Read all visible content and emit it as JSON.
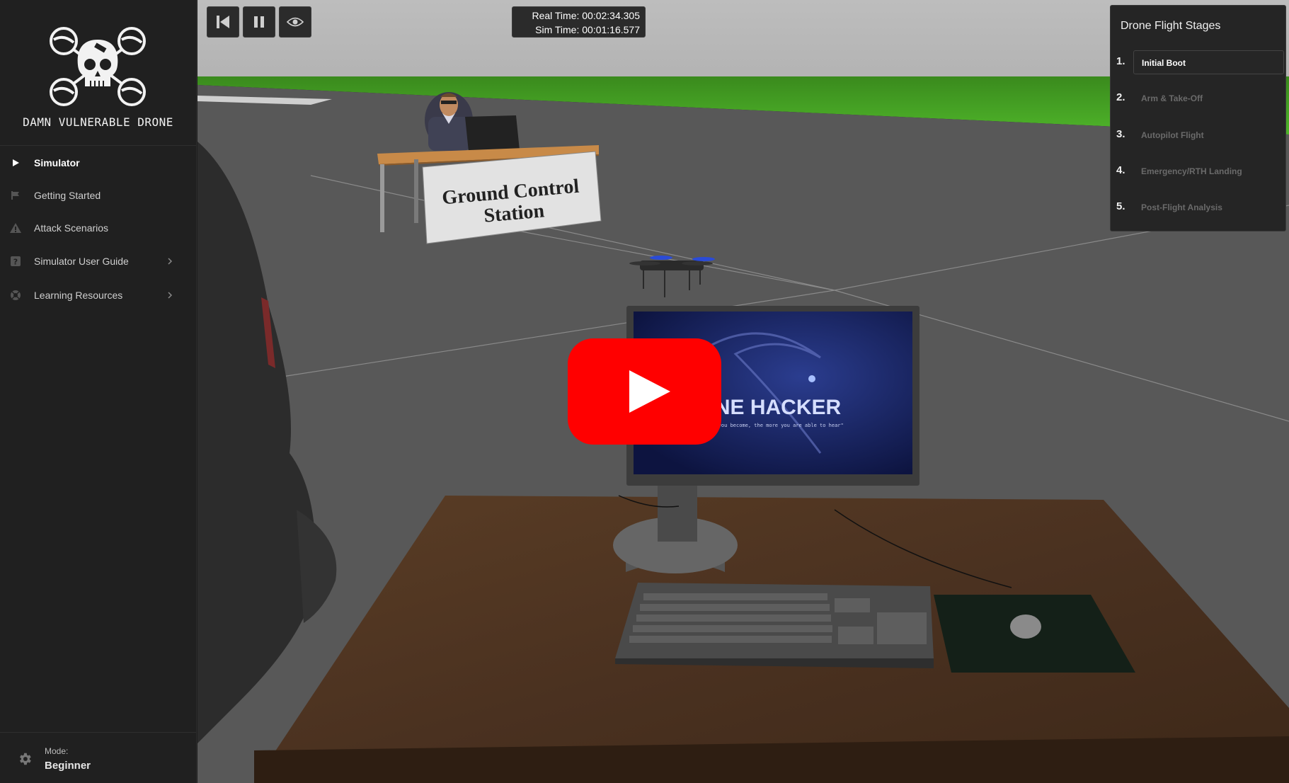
{
  "brand": {
    "title": "DAMN VULNERABLE DRONE"
  },
  "nav": {
    "items": [
      {
        "label": "Simulator",
        "icon": "play-icon",
        "active": true
      },
      {
        "label": "Getting Started",
        "icon": "flag-icon"
      },
      {
        "label": "Attack Scenarios",
        "icon": "warning-icon"
      },
      {
        "label": "Simulator User Guide",
        "icon": "help-icon",
        "has_children": true
      },
      {
        "label": "Learning Resources",
        "icon": "lifebuoy-icon",
        "has_children": true
      }
    ]
  },
  "mode": {
    "label": "Mode:",
    "value": "Beginner"
  },
  "controls": {
    "reset_icon": "skip-back-icon",
    "pause_icon": "pause-icon",
    "view_icon": "eye-icon",
    "real_time": "Real Time: 00:02:34.305",
    "sim_time": "Sim Time: 00:01:16.577"
  },
  "stages": {
    "title": "Drone Flight Stages",
    "items": [
      {
        "num": "1.",
        "label": "Initial Boot",
        "active": true
      },
      {
        "num": "2.",
        "label": "Arm & Take-Off"
      },
      {
        "num": "3.",
        "label": "Autopilot Flight"
      },
      {
        "num": "4.",
        "label": "Emergency/RTH Landing"
      },
      {
        "num": "5.",
        "label": "Post-Flight Analysis"
      }
    ]
  },
  "scene": {
    "gcs_sign_line1": "Ground Control",
    "gcs_sign_line2": "Station",
    "monitor_text": "NE HACKER",
    "monitor_subtext": "\" you become, the more you are able to hear\"",
    "play_button_color": "#ff0000"
  }
}
